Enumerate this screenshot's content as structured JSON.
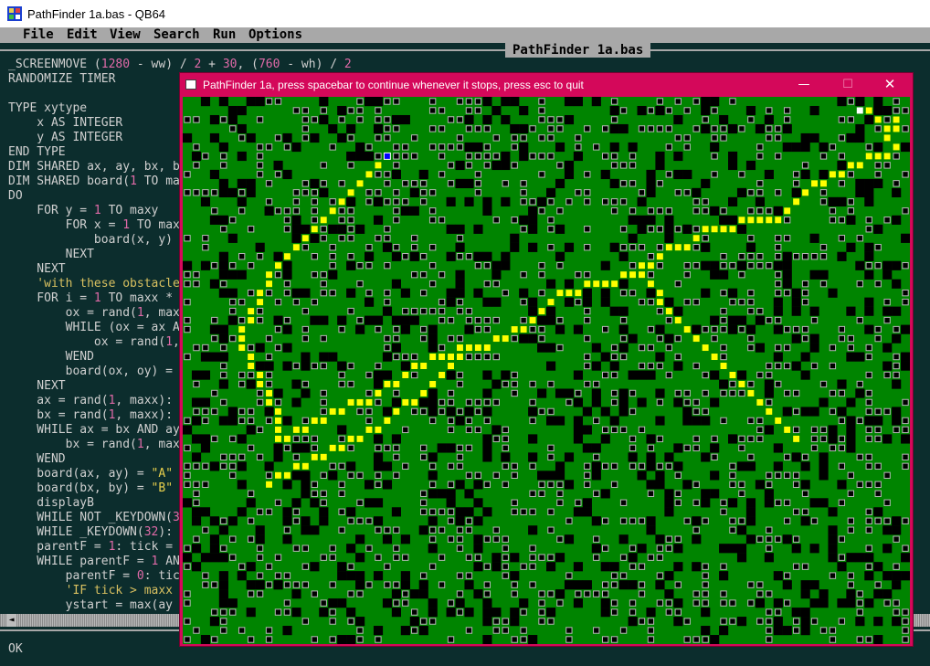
{
  "host": {
    "title": "PathFinder 1a.bas - QB64",
    "menu": [
      "File",
      "Edit",
      "View",
      "Search",
      "Run",
      "Options"
    ],
    "filename": "PathFinder 1a.bas",
    "status": "OK",
    "code_lines": [
      [
        [
          "_SCREENMOVE (",
          "p"
        ],
        [
          "1280",
          "n"
        ],
        [
          " - ww) / ",
          "p"
        ],
        [
          "2",
          "n"
        ],
        [
          " + ",
          "p"
        ],
        [
          "30",
          "n"
        ],
        [
          ", (",
          "p"
        ],
        [
          "760",
          "n"
        ],
        [
          " - wh) / ",
          "p"
        ],
        [
          "2",
          "n"
        ]
      ],
      [
        [
          "RANDOMIZE TIMER",
          "p"
        ]
      ],
      [
        [
          "",
          "p"
        ]
      ],
      [
        [
          "TYPE xytype",
          "p"
        ]
      ],
      [
        [
          "    x AS INTEGER",
          "p"
        ]
      ],
      [
        [
          "    y AS INTEGER",
          "p"
        ]
      ],
      [
        [
          "END TYPE",
          "p"
        ]
      ],
      [
        [
          "DIM SHARED ax, ay, bx, b",
          "p"
        ]
      ],
      [
        [
          "DIM SHARED board(",
          "p"
        ],
        [
          "1",
          "n"
        ],
        [
          " TO ma",
          "p"
        ]
      ],
      [
        [
          "DO",
          "p"
        ]
      ],
      [
        [
          "    FOR y = ",
          "p"
        ],
        [
          "1",
          "n"
        ],
        [
          " TO maxy",
          "p"
        ]
      ],
      [
        [
          "        FOR x = ",
          "p"
        ],
        [
          "1",
          "n"
        ],
        [
          " TO max",
          "p"
        ]
      ],
      [
        [
          "            board(x, y)",
          "p"
        ]
      ],
      [
        [
          "        NEXT",
          "p"
        ]
      ],
      [
        [
          "    NEXT",
          "p"
        ]
      ],
      [
        [
          "    'with these obstacle",
          "c"
        ]
      ],
      [
        [
          "    FOR i = ",
          "p"
        ],
        [
          "1",
          "n"
        ],
        [
          " TO maxx *",
          "p"
        ]
      ],
      [
        [
          "        ox = rand(",
          "p"
        ],
        [
          "1",
          "n"
        ],
        [
          ", max",
          "p"
        ]
      ],
      [
        [
          "        WHILE (ox = ax A",
          "p"
        ]
      ],
      [
        [
          "            ox = rand(",
          "p"
        ],
        [
          "1",
          "n"
        ],
        [
          ",",
          "p"
        ]
      ],
      [
        [
          "        WEND",
          "p"
        ]
      ],
      [
        [
          "        board(ox, oy) =",
          "p"
        ]
      ],
      [
        [
          "    NEXT",
          "p"
        ]
      ],
      [
        [
          "    ax = rand(",
          "p"
        ],
        [
          "1",
          "n"
        ],
        [
          ", maxx):",
          "p"
        ]
      ],
      [
        [
          "    bx = rand(",
          "p"
        ],
        [
          "1",
          "n"
        ],
        [
          ", maxx):",
          "p"
        ]
      ],
      [
        [
          "    WHILE ax = bx AND ay",
          "p"
        ]
      ],
      [
        [
          "        bx = rand(",
          "p"
        ],
        [
          "1",
          "n"
        ],
        [
          ", max",
          "p"
        ]
      ],
      [
        [
          "    WEND",
          "p"
        ]
      ],
      [
        [
          "    board(ax, ay) = ",
          "p"
        ],
        [
          "\"A\"",
          "s"
        ]
      ],
      [
        [
          "    board(bx, by) = ",
          "p"
        ],
        [
          "\"B\"",
          "s"
        ]
      ],
      [
        [
          "    displayB",
          "p"
        ]
      ],
      [
        [
          "    WHILE NOT _KEYDOWN(",
          "p"
        ],
        [
          "3",
          "n"
        ]
      ],
      [
        [
          "    WHILE _KEYDOWN(",
          "p"
        ],
        [
          "32",
          "n"
        ],
        [
          "):",
          "p"
        ]
      ],
      [
        [
          "    parentF = ",
          "p"
        ],
        [
          "1",
          "n"
        ],
        [
          ": tick =",
          "p"
        ]
      ],
      [
        [
          "    WHILE parentF = ",
          "p"
        ],
        [
          "1",
          "n"
        ],
        [
          " AN",
          "p"
        ]
      ],
      [
        [
          "        parentF = ",
          "p"
        ],
        [
          "0",
          "n"
        ],
        [
          ": tic",
          "p"
        ]
      ],
      [
        [
          "        'IF tick > maxx",
          "c"
        ]
      ],
      [
        [
          "        ystart = max(ay",
          "p"
        ]
      ]
    ]
  },
  "pathfinder": {
    "title": "PathFinder 1a, press spacebar to continue whenever it stops, press esc to quit",
    "grid": {
      "cols": 80,
      "rows": 60,
      "colors": {
        "open": "#008400",
        "obstacle": "#000000",
        "path": "#ffff00",
        "start": "#0000ff",
        "goal": "#ffffff"
      },
      "start": [
        22,
        6
      ],
      "goal": [
        74,
        1
      ],
      "path": [
        [
          75,
          1
        ],
        [
          76,
          2
        ],
        [
          77,
          3
        ],
        [
          78,
          2
        ],
        [
          78,
          3
        ],
        [
          77,
          4
        ],
        [
          78,
          5
        ],
        [
          77,
          6
        ],
        [
          76,
          6
        ],
        [
          75,
          6
        ],
        [
          74,
          7
        ],
        [
          73,
          7
        ],
        [
          72,
          8
        ],
        [
          71,
          8
        ],
        [
          70,
          9
        ],
        [
          69,
          9
        ],
        [
          68,
          10
        ],
        [
          67,
          11
        ],
        [
          66,
          12
        ],
        [
          65,
          13
        ],
        [
          64,
          13
        ],
        [
          63,
          13
        ],
        [
          62,
          13
        ],
        [
          61,
          13
        ],
        [
          60,
          14
        ],
        [
          59,
          14
        ],
        [
          58,
          14
        ],
        [
          57,
          14
        ],
        [
          56,
          15
        ],
        [
          55,
          16
        ],
        [
          54,
          16
        ],
        [
          53,
          16
        ],
        [
          52,
          17
        ],
        [
          51,
          18
        ],
        [
          50,
          18
        ],
        [
          49,
          19
        ],
        [
          48,
          19
        ],
        [
          47,
          20
        ],
        [
          46,
          20
        ],
        [
          45,
          20
        ],
        [
          44,
          20
        ],
        [
          43,
          21
        ],
        [
          42,
          21
        ],
        [
          41,
          21
        ],
        [
          40,
          22
        ],
        [
          39,
          23
        ],
        [
          38,
          24
        ],
        [
          37,
          25
        ],
        [
          36,
          25
        ],
        [
          35,
          26
        ],
        [
          34,
          26
        ],
        [
          33,
          27
        ],
        [
          32,
          27
        ],
        [
          31,
          27
        ],
        [
          30,
          27
        ],
        [
          29,
          28
        ],
        [
          28,
          28
        ],
        [
          27,
          28
        ],
        [
          26,
          29
        ],
        [
          25,
          29
        ],
        [
          24,
          30
        ],
        [
          23,
          31
        ],
        [
          22,
          31
        ],
        [
          21,
          32
        ],
        [
          20,
          33
        ],
        [
          19,
          33
        ],
        [
          18,
          33
        ],
        [
          17,
          34
        ],
        [
          16,
          34
        ],
        [
          15,
          35
        ],
        [
          14,
          35
        ],
        [
          13,
          36
        ],
        [
          12,
          36
        ],
        [
          11,
          37
        ],
        [
          10,
          37
        ],
        [
          21,
          7
        ],
        [
          20,
          8
        ],
        [
          19,
          9
        ],
        [
          18,
          10
        ],
        [
          17,
          11
        ],
        [
          16,
          12
        ],
        [
          15,
          13
        ],
        [
          14,
          14
        ],
        [
          13,
          15
        ],
        [
          12,
          16
        ],
        [
          11,
          17
        ],
        [
          10,
          18
        ],
        [
          9,
          19
        ],
        [
          9,
          20
        ],
        [
          8,
          21
        ],
        [
          8,
          22
        ],
        [
          7,
          23
        ],
        [
          7,
          24
        ],
        [
          6,
          25
        ],
        [
          6,
          26
        ],
        [
          6,
          27
        ],
        [
          7,
          28
        ],
        [
          7,
          29
        ],
        [
          8,
          30
        ],
        [
          8,
          31
        ],
        [
          9,
          32
        ],
        [
          9,
          33
        ],
        [
          10,
          34
        ],
        [
          10,
          35
        ],
        [
          10,
          36
        ],
        [
          30,
          28
        ],
        [
          29,
          29
        ],
        [
          28,
          30
        ],
        [
          27,
          31
        ],
        [
          26,
          32
        ],
        [
          25,
          33
        ],
        [
          24,
          33
        ],
        [
          23,
          34
        ],
        [
          22,
          35
        ],
        [
          21,
          36
        ],
        [
          20,
          36
        ],
        [
          19,
          37
        ],
        [
          18,
          37
        ],
        [
          17,
          38
        ],
        [
          16,
          38
        ],
        [
          15,
          39
        ],
        [
          14,
          39
        ],
        [
          13,
          40
        ],
        [
          12,
          40
        ],
        [
          11,
          41
        ],
        [
          10,
          41
        ],
        [
          9,
          42
        ],
        [
          50,
          19
        ],
        [
          51,
          20
        ],
        [
          52,
          21
        ],
        [
          52,
          22
        ],
        [
          53,
          23
        ],
        [
          54,
          24
        ],
        [
          55,
          25
        ],
        [
          56,
          26
        ],
        [
          57,
          27
        ],
        [
          58,
          28
        ],
        [
          59,
          29
        ],
        [
          60,
          30
        ],
        [
          61,
          31
        ],
        [
          62,
          32
        ],
        [
          63,
          33
        ],
        [
          64,
          34
        ],
        [
          65,
          35
        ],
        [
          66,
          36
        ],
        [
          67,
          37
        ]
      ]
    }
  }
}
